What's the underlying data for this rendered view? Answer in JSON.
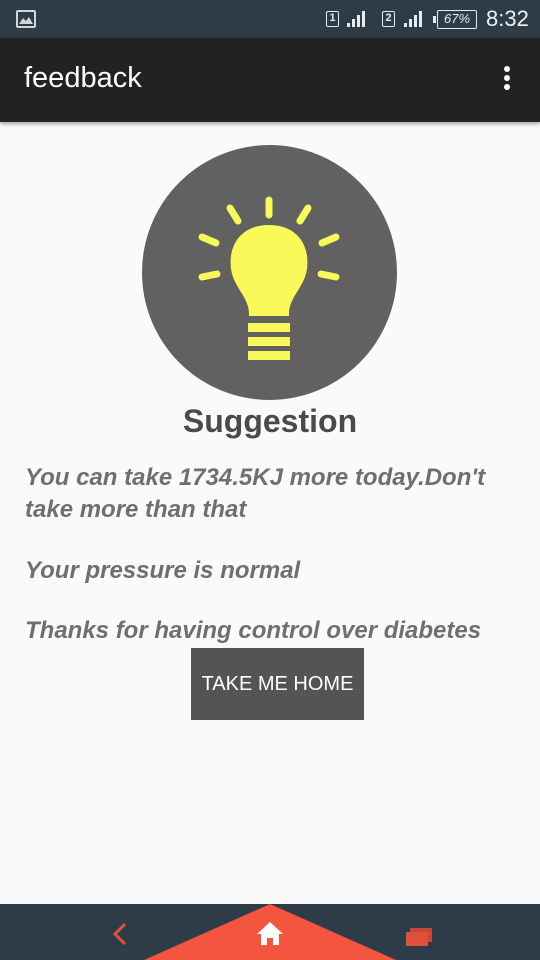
{
  "status_bar": {
    "sim1": "1",
    "sim2": "2",
    "battery": "67%",
    "time": "8:32"
  },
  "app_bar": {
    "title": "feedback",
    "menu_icon": "more-vert-icon"
  },
  "content": {
    "icon": "lightbulb-icon",
    "heading": "Suggestion",
    "messages": [
      "You can take 1734.5KJ more today.Don't take more than that",
      "Your pressure is normal",
      "Thanks for having control over diabetes"
    ],
    "button_label": "TAKE ME HOME"
  },
  "nav_bar": {
    "back_icon": "back-icon",
    "home_icon": "home-icon",
    "recents_icon": "recents-icon"
  },
  "colors": {
    "status_bar": "#2e3c47",
    "app_bar": "#222222",
    "icon_circle": "#616161",
    "bulb": "#f9f95a",
    "button": "#545454",
    "nav_accent": "#f4553f"
  }
}
